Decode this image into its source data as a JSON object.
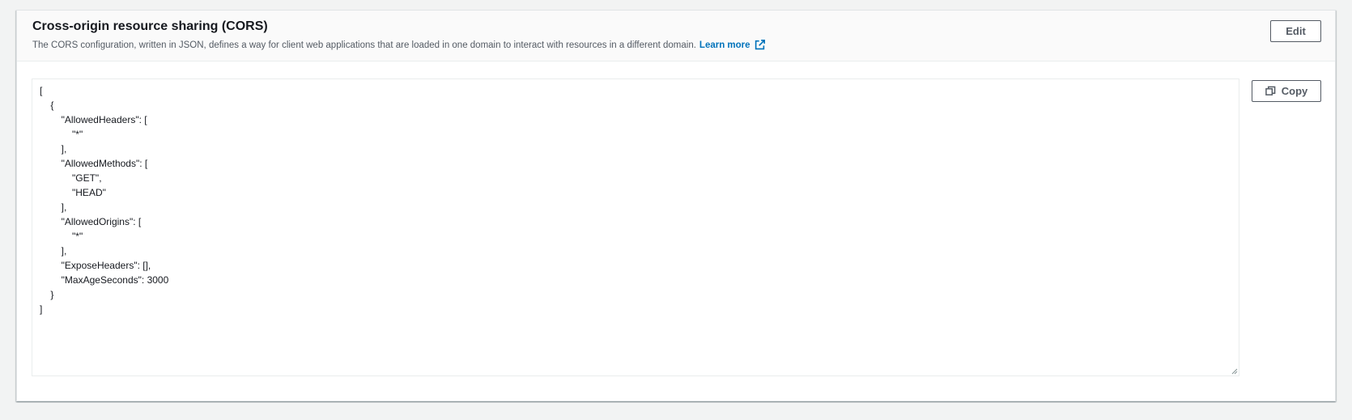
{
  "header": {
    "title": "Cross-origin resource sharing (CORS)",
    "description": "The CORS configuration, written in JSON, defines a way for client web applications that are loaded in one domain to interact with resources in a different domain.",
    "learn_more": "Learn more",
    "edit_label": "Edit"
  },
  "editor": {
    "copy_label": "Copy",
    "lines": [
      "[",
      "    {",
      "        \"AllowedHeaders\": [",
      "            \"*\"",
      "        ],",
      "        \"AllowedMethods\": [",
      "            \"GET\",",
      "            \"HEAD\"",
      "        ],",
      "        \"AllowedOrigins\": [",
      "            \"*\"",
      "        ],",
      "        \"ExposeHeaders\": [],",
      "        \"MaxAgeSeconds\": 3000",
      "    }",
      "]"
    ]
  },
  "colors": {
    "link": "#0073bb",
    "button_border": "#545b64",
    "background": "#f2f3f3"
  },
  "icons": {
    "external_link": "external-link-icon",
    "copy": "copy-icon"
  }
}
